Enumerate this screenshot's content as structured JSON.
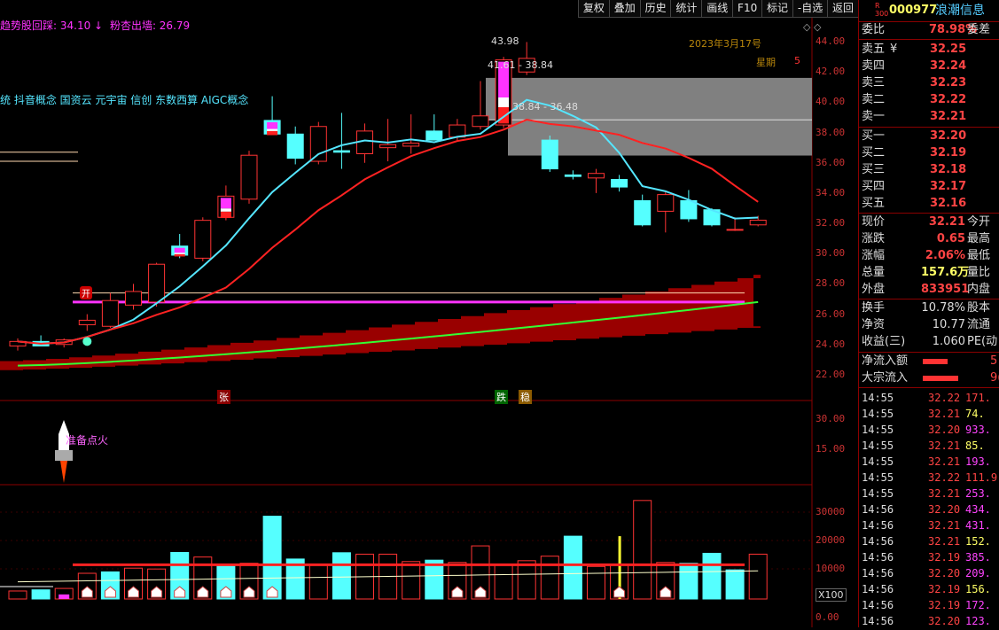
{
  "toolbar": [
    "复权",
    "叠加",
    "历史",
    "统计",
    "画线",
    "F10",
    "标记",
    "-自选",
    "返回"
  ],
  "indicator_top": {
    "item1_label": "趋势股回踩: 34.10",
    "item1_arrow": "↓",
    "item2_label": "粉杏出墙: 26.79"
  },
  "concepts": "统 抖音概念 国资云 元宇宙 信创 东数西算 AIGC概念",
  "annotations": {
    "high": "43.98",
    "range1": "41.61 - 38.84",
    "range2": "38.84 - 36.48",
    "date": "2023年3月17号",
    "weekday": "星期",
    "weekday_num": "5",
    "tag_zhang": "张",
    "tag_die": "跌",
    "tag_wen": "稳",
    "tag_kai": "开",
    "rocket_text": "准备点火",
    "x100": "X100"
  },
  "price_axis": [
    "44.00",
    "42.00",
    "40.00",
    "38.00",
    "36.00",
    "34.00",
    "32.00",
    "30.00",
    "28.00",
    "26.00",
    "24.00",
    "22.00"
  ],
  "ind_axis": [
    "30.00",
    "15.00"
  ],
  "vol_axis": [
    "30000",
    "20000",
    "10000",
    "0.00"
  ],
  "stock": {
    "small": "R\n300",
    "code": "000977",
    "name": "浪潮信息"
  },
  "weibi": {
    "label": "委比",
    "value": "78.98%",
    "label2": "委差"
  },
  "asks": [
    {
      "label": "卖五",
      "mark": "¥",
      "price": "32.25"
    },
    {
      "label": "卖四",
      "mark": "",
      "price": "32.24"
    },
    {
      "label": "卖三",
      "mark": "",
      "price": "32.23"
    },
    {
      "label": "卖二",
      "mark": "",
      "price": "32.22"
    },
    {
      "label": "卖一",
      "mark": "",
      "price": "32.21"
    }
  ],
  "bids": [
    {
      "label": "买一",
      "price": "32.20"
    },
    {
      "label": "买二",
      "price": "32.19"
    },
    {
      "label": "买三",
      "price": "32.18"
    },
    {
      "label": "买四",
      "price": "32.17"
    },
    {
      "label": "买五",
      "price": "32.16"
    }
  ],
  "quote": [
    {
      "label": "现价",
      "value": "32.21",
      "color": "#ff4444",
      "label2": "今开"
    },
    {
      "label": "涨跌",
      "value": "0.65",
      "color": "#ff4444",
      "label2": "最高"
    },
    {
      "label": "涨幅",
      "value": "2.06%",
      "color": "#ff4444",
      "label2": "最低"
    },
    {
      "label": "总量",
      "value": "157.6万",
      "color": "#ffff66",
      "label2": "量比"
    },
    {
      "label": "外盘",
      "value": "833951",
      "color": "#ff4444",
      "label2": "内盘"
    }
  ],
  "stats": [
    {
      "label": "换手",
      "value": "10.78%",
      "label2": "股本"
    },
    {
      "label": "净资",
      "value": "10.77",
      "label2": "流通"
    },
    {
      "label": "收益(三)",
      "value": "1.060",
      "label2": "PE(动"
    }
  ],
  "flows": [
    {
      "label": "净流入额",
      "bar": 0.55,
      "value": "5"
    },
    {
      "label": "大宗流入",
      "bar": 0.8,
      "value": "9("
    }
  ],
  "ticks": [
    {
      "time": "14:55",
      "price": "32.22",
      "vol": "171.",
      "c": "#ff4444",
      "vc": "#ff4444"
    },
    {
      "time": "14:55",
      "price": "32.21",
      "vol": "74.",
      "c": "#ff4444",
      "vc": "#ffff66"
    },
    {
      "time": "14:55",
      "price": "32.20",
      "vol": "933.",
      "c": "#ff4444",
      "vc": "#ff44ff"
    },
    {
      "time": "14:55",
      "price": "32.21",
      "vol": "85.",
      "c": "#ff4444",
      "vc": "#ffff66"
    },
    {
      "time": "14:55",
      "price": "32.21",
      "vol": "193.",
      "c": "#ff4444",
      "vc": "#ff44ff"
    },
    {
      "time": "14:55",
      "price": "32.22",
      "vol": "111.9",
      "c": "#ff4444",
      "vc": "#ff4444"
    },
    {
      "time": "14:55",
      "price": "32.21",
      "vol": "253.",
      "c": "#ff4444",
      "vc": "#ff44ff"
    },
    {
      "time": "14:56",
      "price": "32.20",
      "vol": "434.",
      "c": "#ff4444",
      "vc": "#ff44ff"
    },
    {
      "time": "14:56",
      "price": "32.21",
      "vol": "431.",
      "c": "#ff4444",
      "vc": "#ff44ff"
    },
    {
      "time": "14:56",
      "price": "32.21",
      "vol": "152.",
      "c": "#ff4444",
      "vc": "#ffff66"
    },
    {
      "time": "14:56",
      "price": "32.19",
      "vol": "385.",
      "c": "#ff4444",
      "vc": "#ff44ff"
    },
    {
      "time": "14:56",
      "price": "32.20",
      "vol": "209.",
      "c": "#ff4444",
      "vc": "#ff44ff"
    },
    {
      "time": "14:56",
      "price": "32.19",
      "vol": "156.",
      "c": "#ff4444",
      "vc": "#ffff66"
    },
    {
      "time": "14:56",
      "price": "32.19",
      "vol": "172.",
      "c": "#ff4444",
      "vc": "#ff44ff"
    },
    {
      "time": "14:56",
      "price": "32.20",
      "vol": "123.",
      "c": "#ff4444",
      "vc": "#ff44ff"
    }
  ],
  "colors": {
    "up": "#ff3333",
    "down": "#55ffff",
    "ma_fast": "#55e6ff",
    "ma_slow": "#ff2222",
    "ma_long": "#33ff33",
    "magenta": "#ff33ff",
    "axis": "#cc3333"
  },
  "chart_data": {
    "type": "candlestick",
    "candles": [
      {
        "o": 23.9,
        "h": 24.4,
        "l": 23.6,
        "c": 24.2
      },
      {
        "o": 24.2,
        "h": 24.6,
        "l": 23.9,
        "c": 23.9
      },
      {
        "o": 24.0,
        "h": 24.4,
        "l": 23.8,
        "c": 24.3
      },
      {
        "o": 25.3,
        "h": 26.0,
        "l": 24.9,
        "c": 25.6
      },
      {
        "o": 25.2,
        "h": 27.4,
        "l": 25.1,
        "c": 26.9
      },
      {
        "o": 26.6,
        "h": 28.0,
        "l": 26.3,
        "c": 27.5
      },
      {
        "o": 26.8,
        "h": 29.4,
        "l": 26.5,
        "c": 29.3
      },
      {
        "o": 30.5,
        "h": 31.3,
        "l": 29.7,
        "c": 29.9
      },
      {
        "o": 29.7,
        "h": 32.4,
        "l": 29.5,
        "c": 32.2
      },
      {
        "o": 32.4,
        "h": 34.5,
        "l": 32.2,
        "c": 33.8
      },
      {
        "o": 33.6,
        "h": 36.8,
        "l": 33.3,
        "c": 36.5
      },
      {
        "o": 38.8,
        "h": 40.4,
        "l": 37.9,
        "c": 37.9
      },
      {
        "o": 37.9,
        "h": 38.4,
        "l": 35.9,
        "c": 36.3
      },
      {
        "o": 36.1,
        "h": 38.7,
        "l": 35.9,
        "c": 38.4
      },
      {
        "o": 36.8,
        "h": 39.3,
        "l": 35.6,
        "c": 36.7
      },
      {
        "o": 36.6,
        "h": 38.6,
        "l": 36.0,
        "c": 38.1
      },
      {
        "o": 37.0,
        "h": 38.9,
        "l": 36.1,
        "c": 37.2
      },
      {
        "o": 37.1,
        "h": 39.2,
        "l": 36.6,
        "c": 37.3
      },
      {
        "o": 38.1,
        "h": 39.2,
        "l": 37.6,
        "c": 37.5
      },
      {
        "o": 37.7,
        "h": 38.9,
        "l": 37.4,
        "c": 38.5
      },
      {
        "o": 38.4,
        "h": 41.4,
        "l": 38.2,
        "c": 39.1
      },
      {
        "o": 38.5,
        "h": 43.0,
        "l": 38.3,
        "c": 42.8
      },
      {
        "o": 42.0,
        "h": 43.98,
        "l": 41.8,
        "c": 42.9
      },
      {
        "o": 37.5,
        "h": 37.8,
        "l": 35.4,
        "c": 35.6
      },
      {
        "o": 35.2,
        "h": 35.5,
        "l": 34.9,
        "c": 35.1
      },
      {
        "o": 35.0,
        "h": 35.6,
        "l": 34.0,
        "c": 35.3
      },
      {
        "o": 34.9,
        "h": 35.2,
        "l": 34.1,
        "c": 34.4
      },
      {
        "o": 33.5,
        "h": 33.9,
        "l": 31.8,
        "c": 31.9
      },
      {
        "o": 32.8,
        "h": 34.1,
        "l": 31.4,
        "c": 33.9
      },
      {
        "o": 33.5,
        "h": 34.2,
        "l": 32.1,
        "c": 32.3
      },
      {
        "o": 32.9,
        "h": 33.0,
        "l": 31.8,
        "c": 31.9
      },
      {
        "o": 31.6,
        "h": 32.4,
        "l": 31.5,
        "c": 31.6
      },
      {
        "o": 31.9,
        "h": 32.5,
        "l": 31.8,
        "c": 32.21
      }
    ],
    "volume": [
      2800,
      3200,
      3700,
      9000,
      9500,
      10800,
      10500,
      16300,
      14700,
      11700,
      12500,
      29000,
      14000,
      11800,
      16200,
      15700,
      15700,
      13100,
      13600,
      12800,
      18600,
      11800,
      13400,
      15000,
      22000,
      11400,
      12200,
      34500,
      12800,
      12500,
      16000,
      10200,
      15700
    ],
    "volume_up": [
      true,
      false,
      true,
      true,
      false,
      true,
      true,
      false,
      true,
      false,
      true,
      false,
      false,
      true,
      false,
      true,
      true,
      true,
      false,
      true,
      true,
      true,
      true,
      true,
      false,
      true,
      true,
      true,
      true,
      false,
      false,
      false,
      true
    ],
    "price_range": [
      21.0,
      45.0
    ],
    "volume_range": [
      0,
      36000
    ]
  }
}
